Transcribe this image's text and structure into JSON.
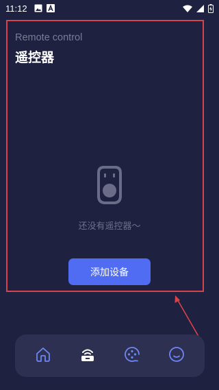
{
  "status_bar": {
    "time": "11:12",
    "left_icons": [
      "image-icon",
      "a-letter-icon"
    ],
    "right_icons": [
      "wifi-icon",
      "signal-icon",
      "battery-charging-icon"
    ]
  },
  "page": {
    "subtitle": "Remote control",
    "title": "遥控器"
  },
  "empty_state": {
    "icon": "remote-control-icon",
    "message": "还没有遥控器～"
  },
  "actions": {
    "add_device_label": "添加设备"
  },
  "bottom_nav": {
    "items": [
      {
        "name": "home",
        "icon": "home-icon",
        "active": false
      },
      {
        "name": "remote",
        "icon": "remote-icon",
        "active": true
      },
      {
        "name": "explore",
        "icon": "film-reel-icon",
        "active": false
      },
      {
        "name": "profile",
        "icon": "smiley-icon",
        "active": false
      }
    ]
  },
  "colors": {
    "background": "#1f2140",
    "accent": "#4f6cf2",
    "annotation": "#d9434b",
    "nav_bg": "#2d3050",
    "nav_icon": "#6e86f5"
  }
}
